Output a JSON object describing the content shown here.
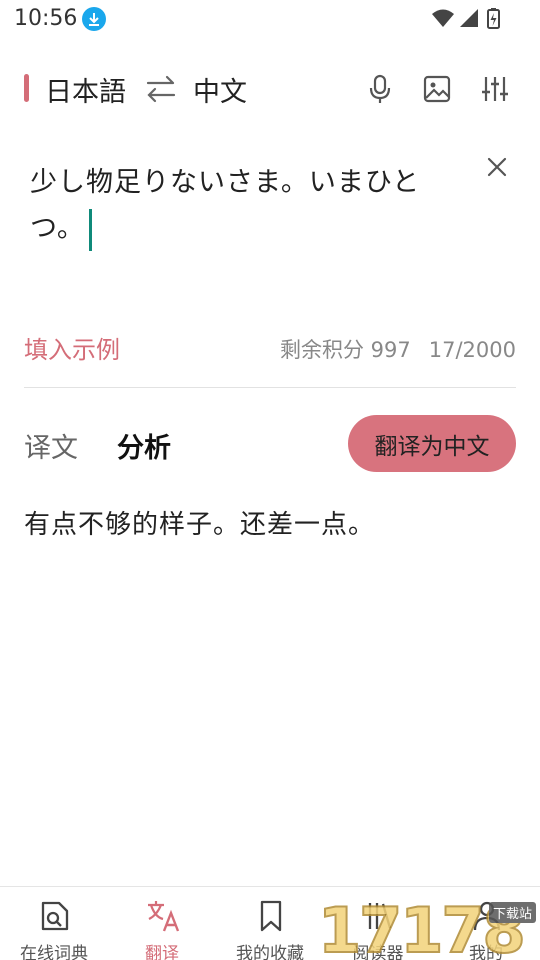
{
  "status_bar": {
    "time": "10:56",
    "download_icon": "download-icon",
    "icons": [
      "wifi-icon",
      "signal-icon",
      "battery-icon"
    ]
  },
  "language_bar": {
    "source_language": "日本語",
    "target_language": "中文",
    "swap_icon": "swap-arrows-icon",
    "tools": [
      "microphone-icon",
      "image-icon",
      "settings-sliders-icon"
    ],
    "accent_color": "#d46d78"
  },
  "input": {
    "text": "少し物足りないさま。いまひとつ。",
    "clear_icon": "close-icon"
  },
  "actions": {
    "example_label": "填入示例",
    "credits_label": "剩余积分 997",
    "char_count": "17/2000"
  },
  "result": {
    "tabs": [
      {
        "label": "译文",
        "active": false
      },
      {
        "label": "分析",
        "active": true
      }
    ],
    "translate_button": "翻译为中文",
    "translated_text": "有点不够的样子。还差一点。"
  },
  "bottom_nav": {
    "items": [
      {
        "label": "在线词典",
        "icon": "dictionary-search-icon",
        "active": false
      },
      {
        "label": "翻译",
        "icon": "translate-icon",
        "active": true
      },
      {
        "label": "我的收藏",
        "icon": "bookmark-icon",
        "active": false
      },
      {
        "label": "阅读器",
        "icon": "reader-icon",
        "active": false
      },
      {
        "label": "我的",
        "icon": "user-icon",
        "active": false
      }
    ]
  },
  "watermark": {
    "text": "17178",
    "tag": "下载站"
  }
}
